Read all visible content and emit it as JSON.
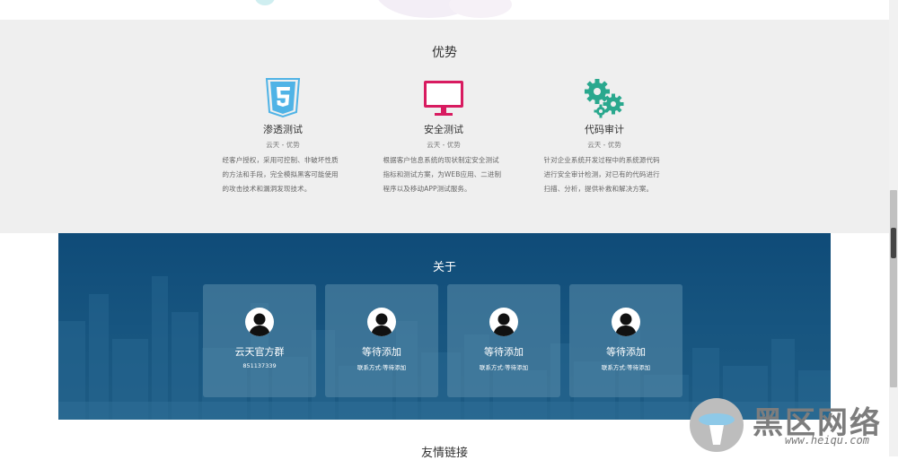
{
  "advantages": {
    "title": "优势",
    "items": [
      {
        "icon": "html5-icon",
        "name": "渗透测试",
        "sub": "云天 - 优势",
        "desc": "经客户授权，采用可控制、非破坏性质的方法和手段，完全模拟黑客可能使用的攻击技术和漏洞发现技术。"
      },
      {
        "icon": "monitor-icon",
        "name": "安全测试",
        "sub": "云天 - 优势",
        "desc": "根据客户信息系统的现状制定安全测试指标和测试方案，为WEB应用、二进制程序以及移动APP测试服务。"
      },
      {
        "icon": "gears-icon",
        "name": "代码审计",
        "sub": "云天 - 优势",
        "desc": "针对企业系统开发过程中的系统源代码进行安全审计检测，对已有的代码进行扫描、分析，提供补救和解决方案。"
      }
    ]
  },
  "about": {
    "title": "关于",
    "cards": [
      {
        "name": "云天官方群",
        "contact": "851137339"
      },
      {
        "name": "等待添加",
        "contact": "联系方式:等待添加"
      },
      {
        "name": "等待添加",
        "contact": "联系方式:等待添加"
      },
      {
        "name": "等待添加",
        "contact": "联系方式:等待添加"
      }
    ]
  },
  "links": {
    "title": "友情链接"
  },
  "watermark": {
    "text": "黑区网络",
    "url": "www.heiqu.com"
  },
  "colors": {
    "html5": "#4fb3e6",
    "monitor": "#d81b60",
    "gears": "#2aa88e",
    "about_bg": "#0f4b78"
  }
}
